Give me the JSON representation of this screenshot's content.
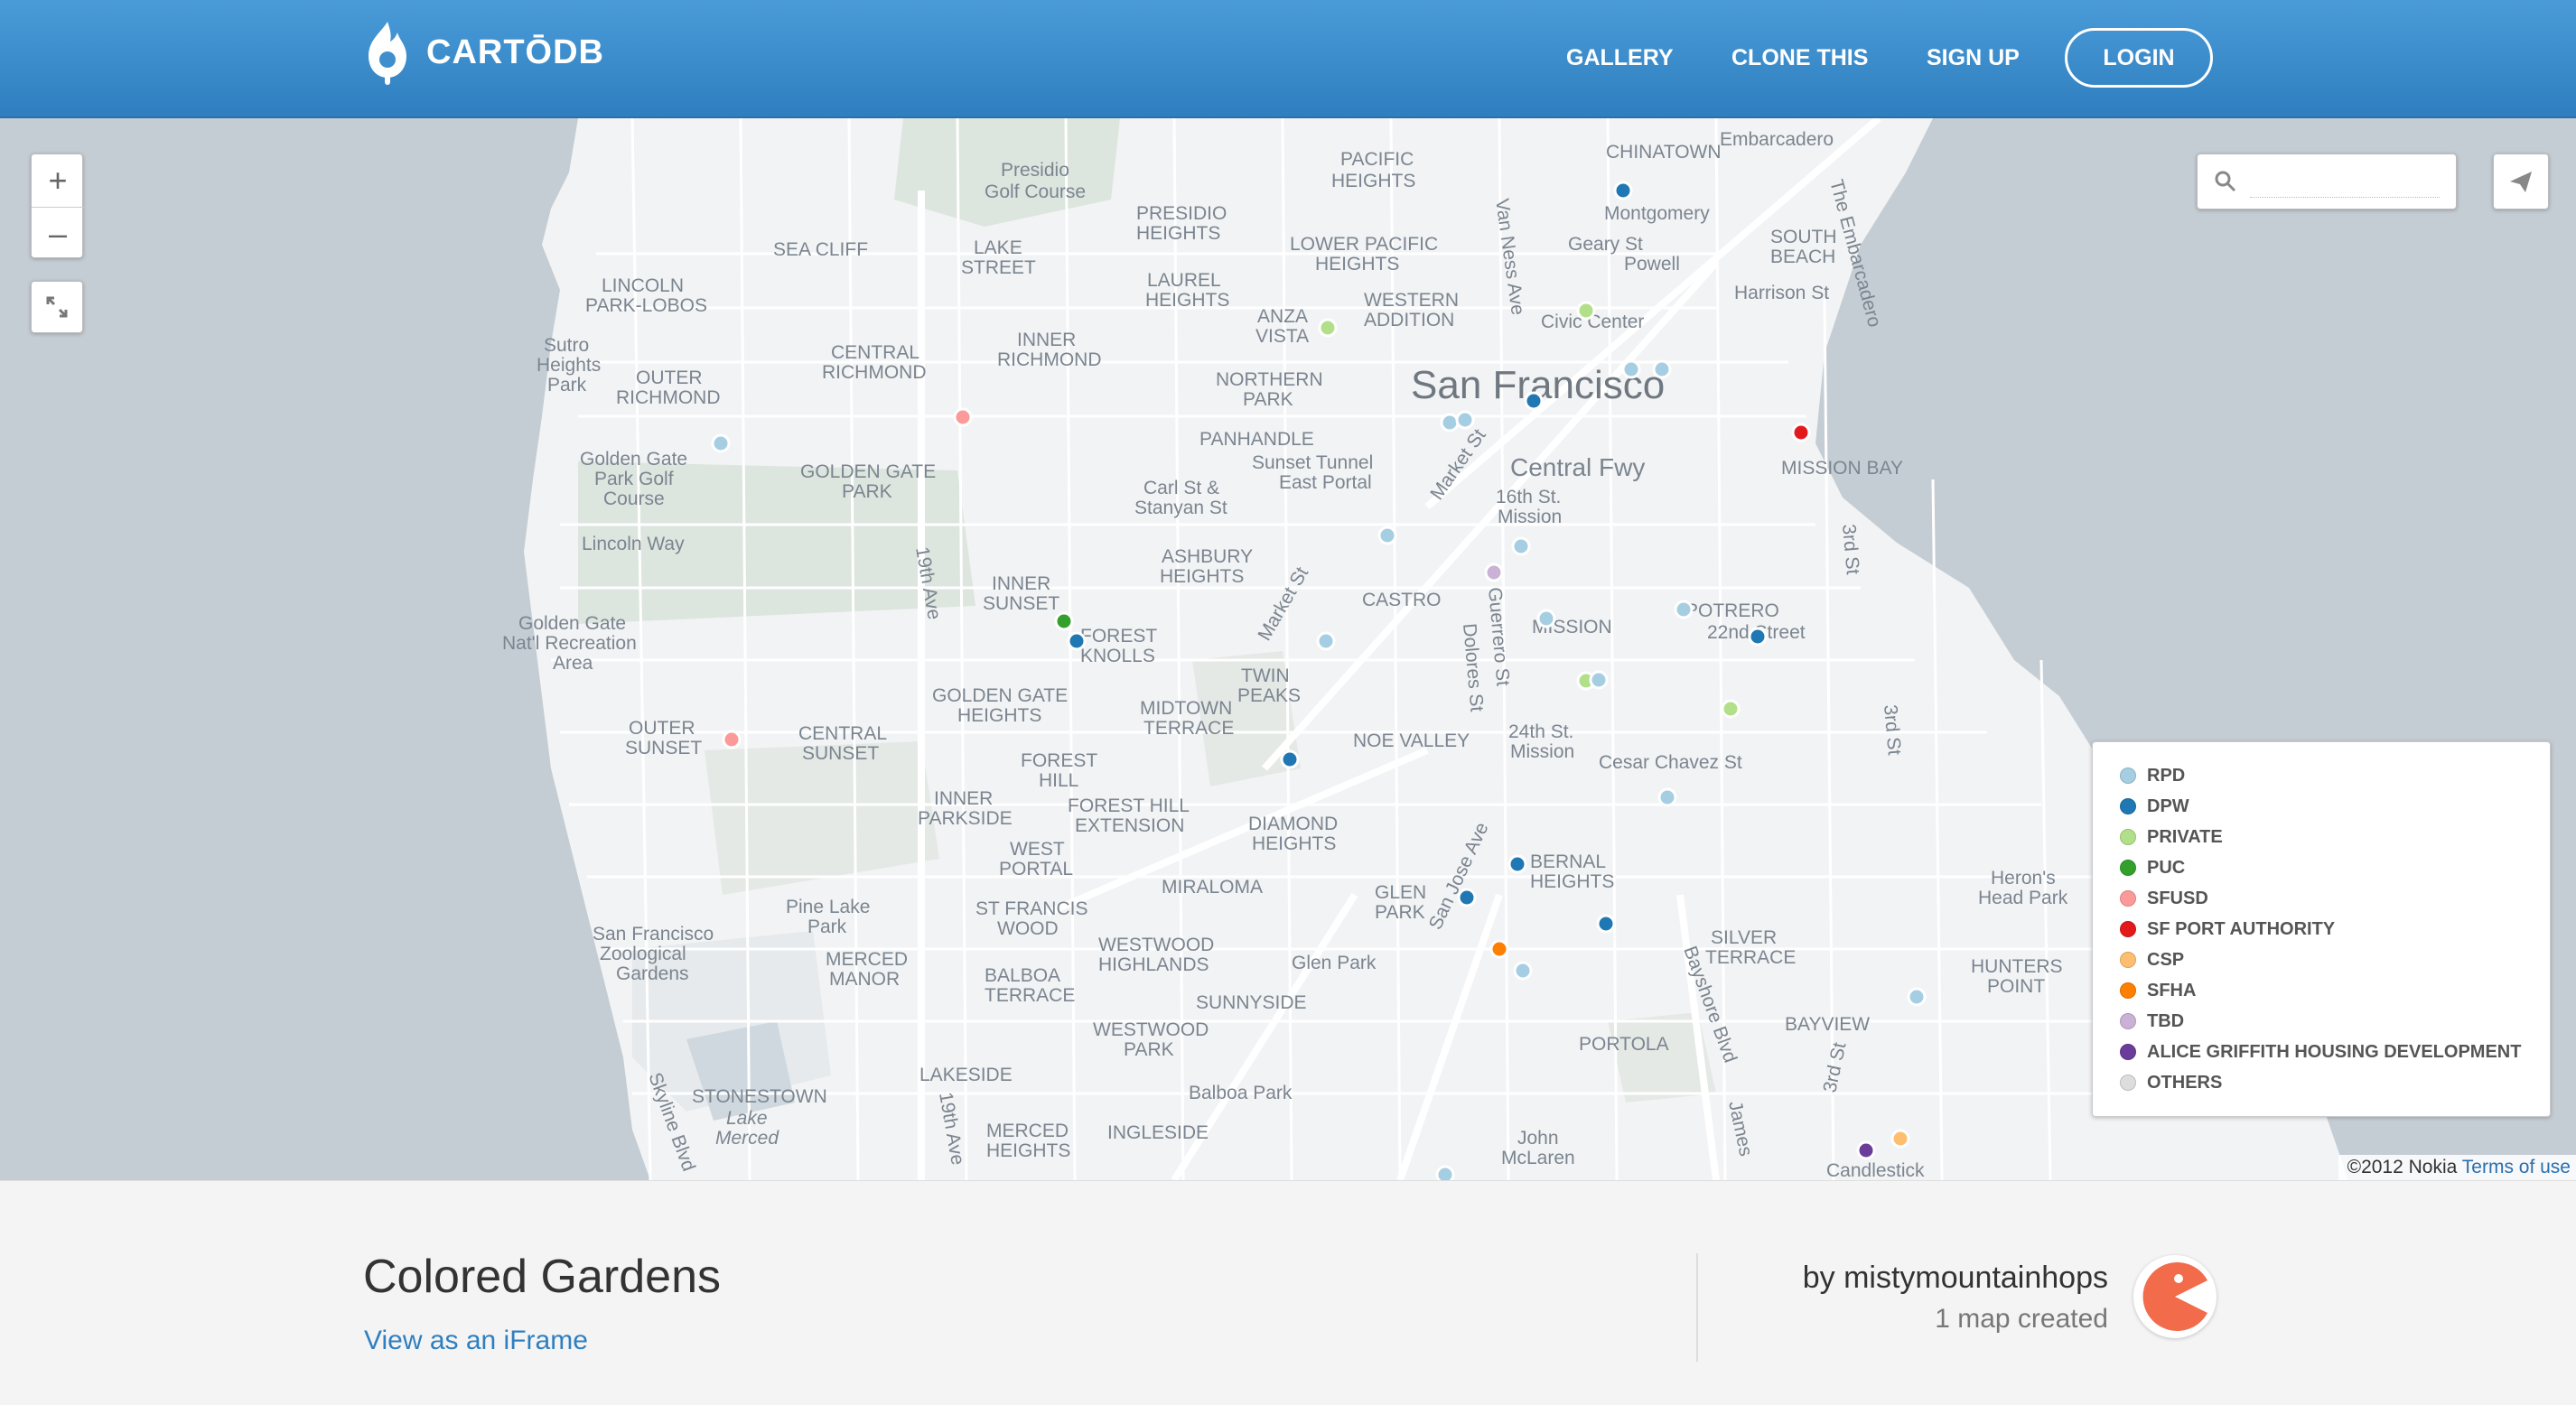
{
  "header": {
    "logo_text": "CARTŌDB",
    "nav": [
      {
        "label": "GALLERY"
      },
      {
        "label": "CLONE THIS"
      },
      {
        "label": "SIGN UP"
      }
    ],
    "login_label": "LOGIN"
  },
  "map": {
    "zoom_in": "+",
    "zoom_out": "–",
    "search_placeholder": "",
    "place_labels": [
      "CHINATOWN",
      "Embarcadero",
      "PACIFIC HEIGHTS",
      "Presidio Golf Course",
      "PRESIDIO HEIGHTS",
      "SEA CLIFF",
      "LAKE STREET",
      "LOWER PACIFIC HEIGHTS",
      "Montgomery",
      "Geary St",
      "SOUTH BEACH",
      "LINCOLN PARK-LOBOS",
      "LAUREL HEIGHTS",
      "Powell",
      "Sutro Heights Park",
      "OUTER RICHMOND",
      "CENTRAL RICHMOND",
      "INNER RICHMOND",
      "ANZA VISTA",
      "WESTERN ADDITION",
      "Civic Center",
      "Harrison St",
      "San Francisco",
      "NORTHERN PARK",
      "PANHANDLE",
      "Golden Gate Park Golf Course",
      "GOLDEN GATE PARK",
      "Sunset Tunnel East Portal",
      "Central Fwy",
      "MISSION BAY",
      "Lincoln Way",
      "Carl St & Stanyan St",
      "16th St. Mission",
      "ASHBURY HEIGHTS",
      "INNER SUNSET",
      "CASTRO",
      "POTRERO",
      "22nd Street",
      "MISSION",
      "Golden Gate Nat'l Recreation Area",
      "FOREST KNOLLS",
      "TWIN PEAKS",
      "OUTER SUNSET",
      "CENTRAL SUNSET",
      "GOLDEN GATE HEIGHTS",
      "MIDTOWN TERRACE",
      "NOE VALLEY",
      "24th St. Mission",
      "Cesar Chavez St",
      "FOREST HILL",
      "INNER PARKSIDE",
      "FOREST HILL EXTENSION",
      "DIAMOND HEIGHTS",
      "WEST PORTAL",
      "BERNAL HEIGHTS",
      "MIRALOMA",
      "Heron's Head Park",
      "GLEN PARK",
      "Pine Lake Park",
      "ST FRANCIS WOOD",
      "San Francisco Zoological Gardens",
      "MERCED MANOR",
      "WESTWOOD HIGHLANDS",
      "Glen Park",
      "SILVER TERRACE",
      "BALBOA TERRACE",
      "HUNTERS POINT",
      "SUNNYSIDE",
      "WESTWOOD PARK",
      "PORTOLA",
      "BAYVIEW",
      "LAKESIDE",
      "STONESTOWN",
      "Lake Merced",
      "Balboa Park",
      "MERCED HEIGHTS",
      "INGLESIDE",
      "John McLaren",
      "Candlestick",
      "19th Ave",
      "Van Ness Ave",
      "Market St",
      "Dolores St",
      "Guerrero St",
      "Bayshore Blvd",
      "3rd St",
      "The Embarcadero",
      "Skyline Blvd",
      "San Jose Ave",
      "James"
    ],
    "legend": [
      {
        "label": "RPD",
        "color": "#a6cee3"
      },
      {
        "label": "DPW",
        "color": "#1f78b4"
      },
      {
        "label": "PRIVATE",
        "color": "#b2df8a"
      },
      {
        "label": "PUC",
        "color": "#33a02c"
      },
      {
        "label": "SFUSD",
        "color": "#fb9a99"
      },
      {
        "label": "SF PORT AUTHORITY",
        "color": "#e31a1c"
      },
      {
        "label": "CSP",
        "color": "#fdbf6f"
      },
      {
        "label": "SFHA",
        "color": "#ff7f00"
      },
      {
        "label": "TBD",
        "color": "#cab2d6"
      },
      {
        "label": "ALICE GRIFFITH HOUSING DEVELOPMENT",
        "color": "#6a3d9a"
      },
      {
        "label": "OTHERS",
        "color": "#dddddd"
      }
    ],
    "attribution_text": "©2012 Nokia",
    "attribution_link": "Terms of use"
  },
  "footer": {
    "title": "Colored Gardens",
    "iframe_link": "View as an iFrame",
    "author": "by mistymountainhops",
    "maps_count": "1 map created"
  },
  "colors": {
    "header_top": "#4a9bd8",
    "header_bottom": "#2f7fc0",
    "link": "#2f7fc0",
    "avatar": "#f26b4a"
  },
  "icons": [
    "cartodb-flame-icon",
    "zoom-in-icon",
    "zoom-out-icon",
    "fullscreen-icon",
    "search-icon",
    "share-icon",
    "avatar-pacman-icon"
  ]
}
